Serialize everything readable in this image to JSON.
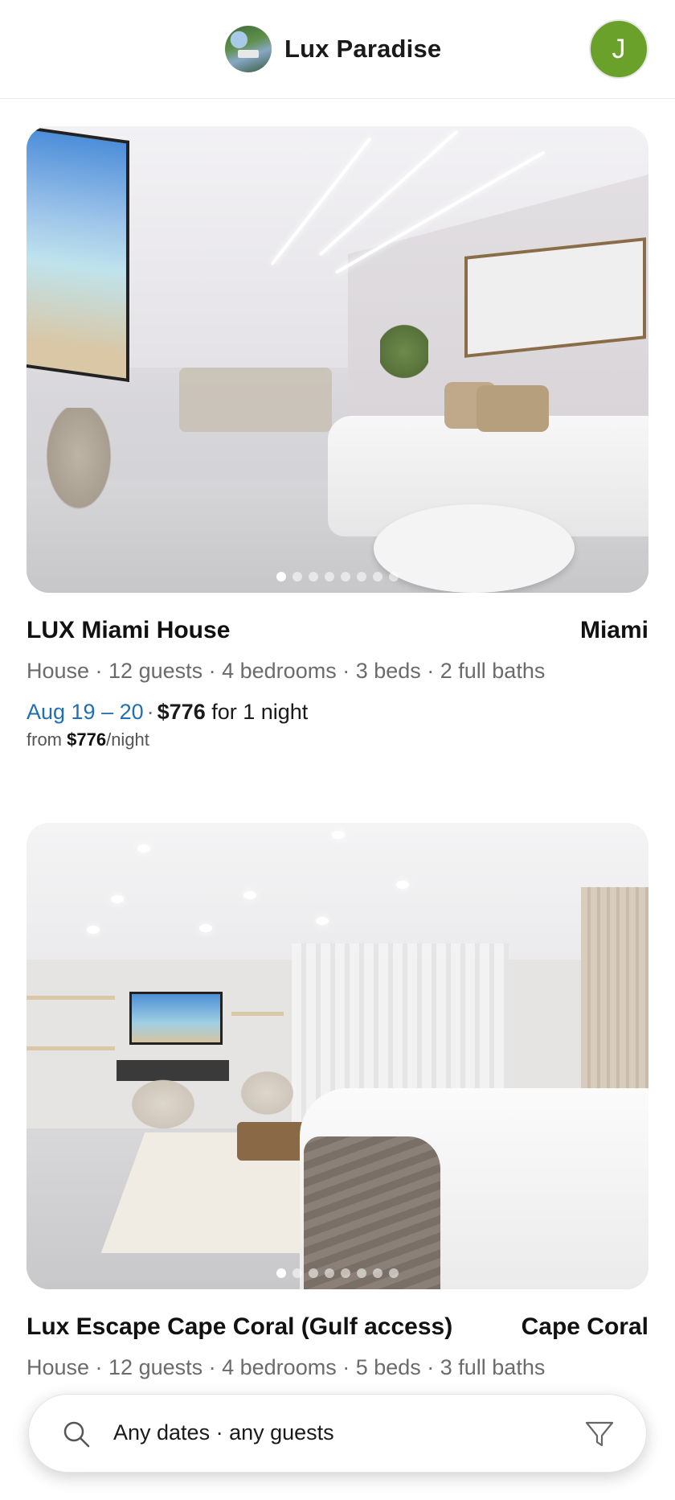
{
  "header": {
    "brand_name": "Lux Paradise",
    "avatar_initial": "J",
    "avatar_color": "#6aa12b"
  },
  "listings": [
    {
      "title": "LUX Miami House",
      "city": "Miami",
      "details": "House · 12 guests · 4 bedrooms · 3 beds · 2 full baths",
      "dates": "Aug 19 – 20",
      "price": "$776",
      "price_suffix": "for 1 night",
      "from_prefix": "from",
      "from_price": "$776",
      "from_suffix": "/night",
      "photo_count": 8,
      "active_photo_index": 0
    },
    {
      "title": "Lux Escape Cape Coral (Gulf access)",
      "city": "Cape Coral",
      "details": "House · 12 guests · 4 bedrooms · 5 beds · 3 full baths",
      "photo_count": 8,
      "active_photo_index": 0
    }
  ],
  "search": {
    "text": "Any dates · any guests",
    "icon": "search-icon",
    "filter_icon": "filter-icon"
  },
  "colors": {
    "link_blue": "#1f6fb2",
    "muted_text": "#6b6b6b"
  }
}
